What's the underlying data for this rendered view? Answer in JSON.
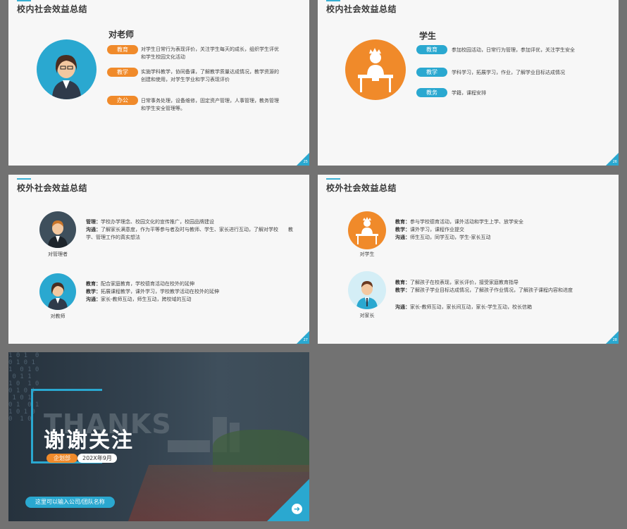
{
  "slide1": {
    "title": "校内社会效益总结",
    "name": "对老师",
    "items": [
      {
        "tag": "教育",
        "text": "对学生日常行为表现评价，关注学生每天的成长，组织学生评优和学生校园文化活动"
      },
      {
        "tag": "教学",
        "text": "实施学科教学，协同备课，了解教学质量达成情况，教学资源的创建和使用，对学生学业和学习表现评价"
      },
      {
        "tag": "办公",
        "text": "日常事务处理，设备维修，固定资产管理，人事管理，教务管理和学生安全管理等。"
      }
    ],
    "page": "25"
  },
  "slide2": {
    "title": "校内社会效益总结",
    "name": "学生",
    "items": [
      {
        "tag": "教育",
        "text": "参加校园活动，日常行为管理，参加评优，关注学生安全"
      },
      {
        "tag": "教学",
        "text": "学科学习，拓展学习，作业，了解学业目标达成情况"
      },
      {
        "tag": "教务",
        "text": "学籍，课程安排"
      }
    ],
    "page": "26"
  },
  "slide3": {
    "title": "校外社会效益总结",
    "blocks": [
      {
        "caption": "对管理者",
        "lines": [
          {
            "k": "管理：",
            "v": "学校办学理念、校园文化的宣传推广，校园品牌建设"
          },
          {
            "k": "沟通：",
            "v": "了解家长满意度，作为平等参与者及时与教师、学生、家长进行互动，了解对学校　　教学、管理工作的真实想法"
          }
        ]
      },
      {
        "caption": "对教师",
        "lines": [
          {
            "k": "教育：",
            "v": "配合家庭教育，学校德育活动在校外的延伸"
          },
          {
            "k": "教学：",
            "v": "拓展课程教学，课外学习，学校教学活动在校外的延伸"
          },
          {
            "k": "沟通：",
            "v": "家长-教师互动，师生互动，跨校域的互动"
          }
        ]
      }
    ],
    "page": "27"
  },
  "slide4": {
    "title": "校外社会效益总结",
    "blocks": [
      {
        "caption": "对学生",
        "lines": [
          {
            "k": "教育：",
            "v": "参与学校德育活动，课外活动和学生上学、放学安全"
          },
          {
            "k": "教学：",
            "v": "课外学习，课程作业提交"
          },
          {
            "k": "沟通：",
            "v": "师生互动，同学互动，学生-家长互动"
          }
        ]
      },
      {
        "caption": "对家长",
        "lines": [
          {
            "k": "教育：",
            "v": "了解孩子在校表现，家长评价，接受家庭教育指导"
          },
          {
            "k": "教学：",
            "v": "了解孩子学业目标达成情况，了解孩子作业情况，了解孩子课程内容和进度"
          },
          {
            "k": "沟通：",
            "v": "家长-教师互动，家长间互动，家长-学生互动，校长信箱"
          }
        ]
      }
    ],
    "page": "28"
  },
  "slide5": {
    "thanks_bg": "THANKS",
    "title": "谢谢关注",
    "dept": "企划部",
    "date": "202X年9月",
    "company": "这里可以输入公司/团队名称",
    "digits": "1 0 1  0\n0 1 0 1\n1  0 1 0\n 0 1 1\n1 0  1 0\n0 1 0 1\n 1 0 1\n0 1  0 1\n1 0 1 0\n0  1 0",
    "arrow": "➜"
  },
  "colors": {
    "accent": "#2aa8d0",
    "orange": "#f08a2a"
  }
}
